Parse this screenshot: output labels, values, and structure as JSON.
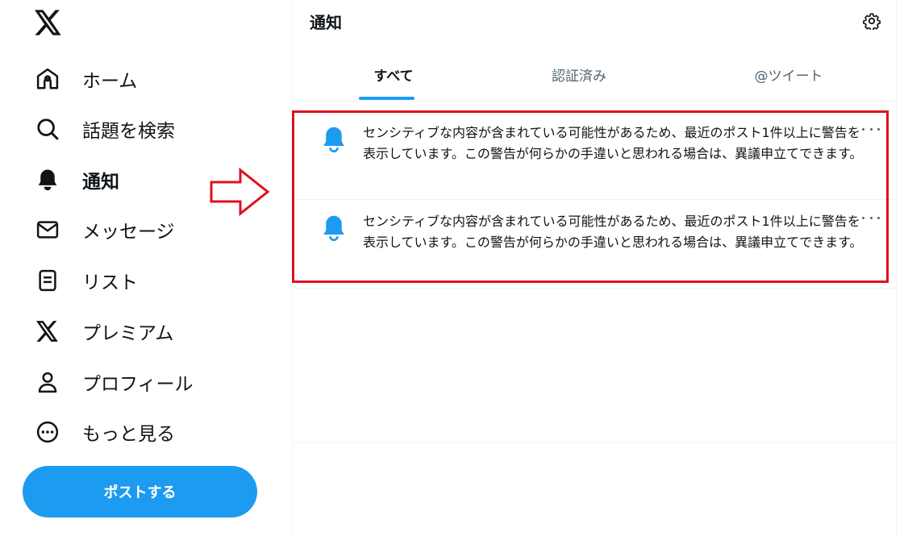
{
  "sidebar": {
    "logo_icon": "x-logo-icon",
    "items": [
      {
        "label": "ホーム",
        "icon": "home-icon"
      },
      {
        "label": "話題を検索",
        "icon": "search-icon"
      },
      {
        "label": "通知",
        "icon": "bell-icon",
        "active": true
      },
      {
        "label": "メッセージ",
        "icon": "mail-icon"
      },
      {
        "label": "リスト",
        "icon": "list-icon"
      },
      {
        "label": "プレミアム",
        "icon": "x-logo-icon"
      },
      {
        "label": "プロフィール",
        "icon": "person-icon"
      },
      {
        "label": "もっと見る",
        "icon": "more-circle-icon"
      }
    ],
    "post_button": "ポストする"
  },
  "header": {
    "title": "通知",
    "settings_icon": "gear-icon"
  },
  "tabs": [
    {
      "label": "すべて",
      "active": true
    },
    {
      "label": "認証済み"
    },
    {
      "label": "@ツイート"
    }
  ],
  "notifications": [
    {
      "icon": "bell-icon",
      "text": "センシティブな内容が含まれている可能性があるため、最近のポスト1件以上に警告を表示しています。この警告が何らかの手違いと思われる場合は、異議申立てできます。"
    },
    {
      "icon": "bell-icon",
      "text": "センシティブな内容が含まれている可能性があるため、最近のポスト1件以上に警告を表示しています。この警告が何らかの手違いと思われる場合は、異議申立てできます。"
    }
  ],
  "colors": {
    "accent": "#1d9bf0",
    "highlight": "#e0101e",
    "text": "#0f1419",
    "muted": "#536471"
  }
}
